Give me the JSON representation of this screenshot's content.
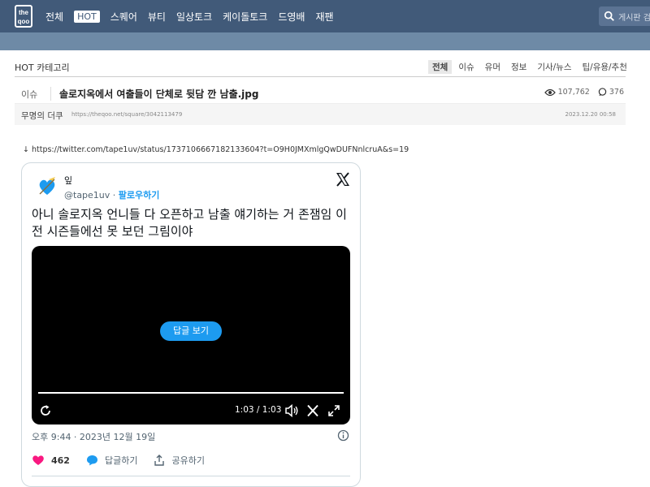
{
  "nav": {
    "logo_text": "the qoo",
    "items": [
      {
        "label": "전체",
        "active": false
      },
      {
        "label": "HOT",
        "active": true
      },
      {
        "label": "스퀘어",
        "active": false
      },
      {
        "label": "뷰티",
        "active": false
      },
      {
        "label": "일상토크",
        "active": false
      },
      {
        "label": "케이돌토크",
        "active": false
      },
      {
        "label": "드영배",
        "active": false
      },
      {
        "label": "재팬",
        "active": false
      }
    ],
    "search_placeholder": "게시판 검"
  },
  "category": {
    "title": "HOT 카테고리",
    "tabs": [
      {
        "label": "전체",
        "active": true
      },
      {
        "label": "이슈",
        "active": false
      },
      {
        "label": "유머",
        "active": false
      },
      {
        "label": "정보",
        "active": false
      },
      {
        "label": "기사/뉴스",
        "active": false
      },
      {
        "label": "팁/유용/추천",
        "active": false
      }
    ]
  },
  "post": {
    "category": "이슈",
    "title": "솔로지옥에서 여출들이 단체로 뒷담 깐 남출.jpg",
    "views": "107,762",
    "comments": "376",
    "author": "무명의 더쿠",
    "url": "https://theqoo.net/square/3042113479",
    "date": "2023.12.20 00:58",
    "link_text": "↓ https://twitter.com/tape1uv/status/1737106667182133604?t=O9H0JMXmlgQwDUFNnlcruA&s=19"
  },
  "tweet": {
    "name": "잎",
    "handle": "@tape1uv",
    "dot": " · ",
    "follow_label": "팔로우하기",
    "text": "아니 솔로지옥 언니들 다 오픈하고 남출 얘기하는 거 존잼임 이전 시즌들에선 못 보던 그림이야",
    "video": {
      "reply_button_label": "답글 보기",
      "time_display": "1:03 / 1:03",
      "progress_fraction": 1.0
    },
    "timestamp": "오후 9:44 · 2023년 12월 19일",
    "likes": "462",
    "reply_label": "답글하기",
    "share_label": "공유하기"
  },
  "colors": {
    "nav_bg": "#415a79",
    "subbar_bg": "#6e8aa6",
    "twitter_blue": "#1d9bf0",
    "like_pink": "#f91880"
  }
}
